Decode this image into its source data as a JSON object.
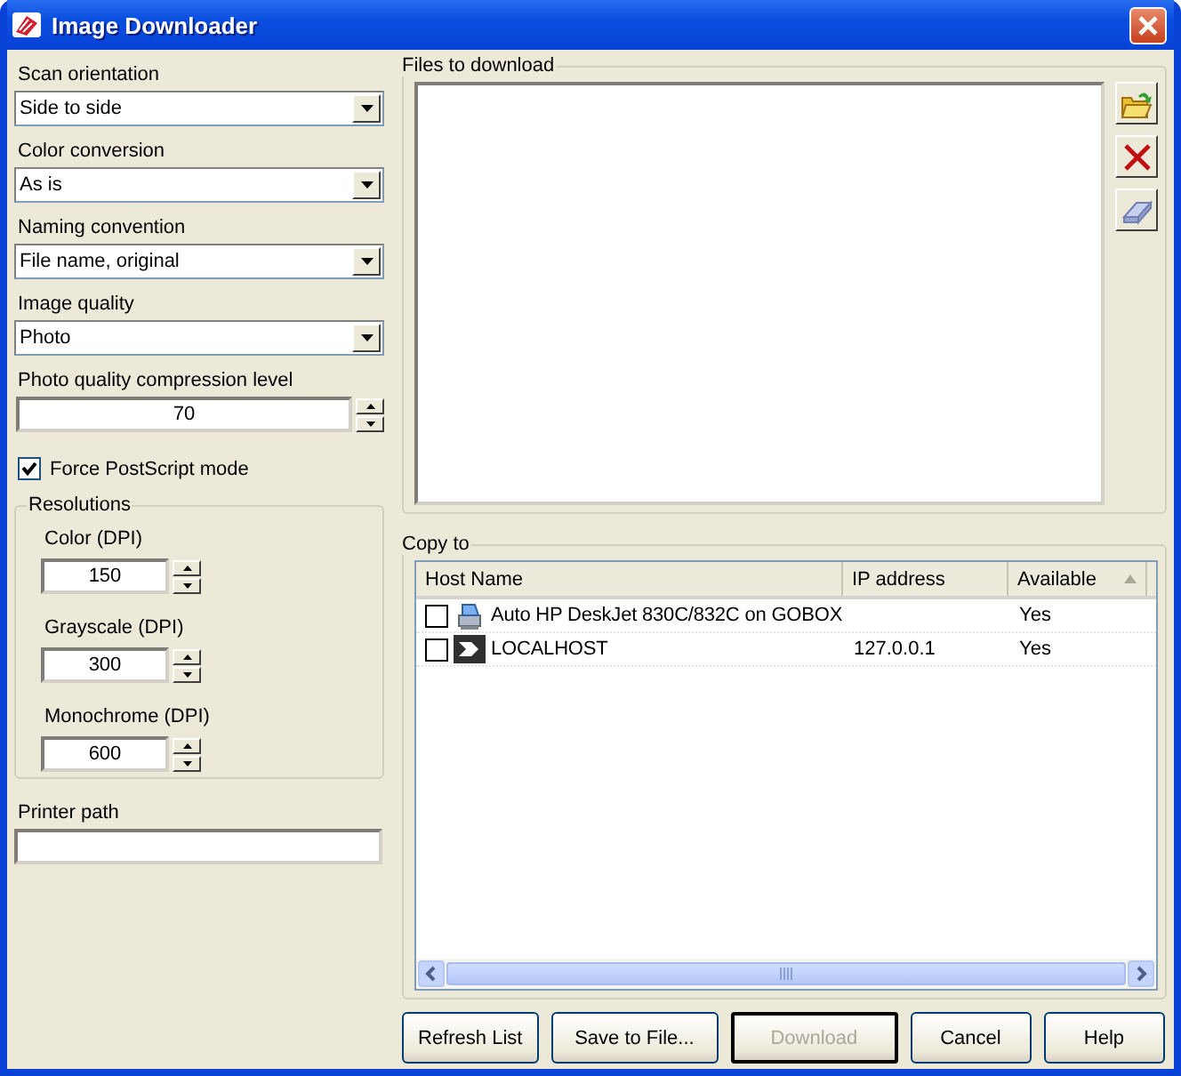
{
  "window": {
    "title": "Image Downloader"
  },
  "combos": [
    {
      "label": "Scan orientation",
      "value": "Side to side"
    },
    {
      "label": "Color conversion",
      "value": "As is"
    },
    {
      "label": "Naming convention",
      "value": "File name, original"
    },
    {
      "label": "Image quality",
      "value": "Photo"
    }
  ],
  "compression": {
    "label": "Photo quality compression level",
    "value": "70"
  },
  "force_postscript": {
    "label": "Force PostScript mode",
    "checked": true
  },
  "resolutions": {
    "title": "Resolutions",
    "spins": [
      {
        "label": "Color (DPI)",
        "value": "150"
      },
      {
        "label": "Grayscale (DPI)",
        "value": "300"
      },
      {
        "label": "Monochrome (DPI)",
        "value": "600"
      }
    ]
  },
  "printer_path": {
    "label": "Printer path"
  },
  "files": {
    "title": "Files to download"
  },
  "copy_to": {
    "title": "Copy to",
    "columns": [
      {
        "label": "Host Name",
        "sorted": false
      },
      {
        "label": "IP address",
        "sorted": false
      },
      {
        "label": "Available",
        "sorted": true
      }
    ],
    "rows": [
      {
        "kind": "printer",
        "checked": false,
        "host": "Auto HP DeskJet 830C/832C on GOBOX",
        "ip": "",
        "available": "Yes"
      },
      {
        "kind": "arrow",
        "checked": false,
        "host": "LOCALHOST",
        "ip": "127.0.0.1",
        "available": "Yes"
      }
    ]
  },
  "buttons": [
    {
      "label": "Refresh List",
      "disabled": false,
      "default": false
    },
    {
      "label": "Save to File...",
      "disabled": false,
      "default": false
    },
    {
      "label": "Download",
      "disabled": true,
      "default": true
    },
    {
      "label": "Cancel",
      "disabled": false,
      "default": false
    },
    {
      "label": "Help",
      "disabled": false,
      "default": false
    }
  ]
}
